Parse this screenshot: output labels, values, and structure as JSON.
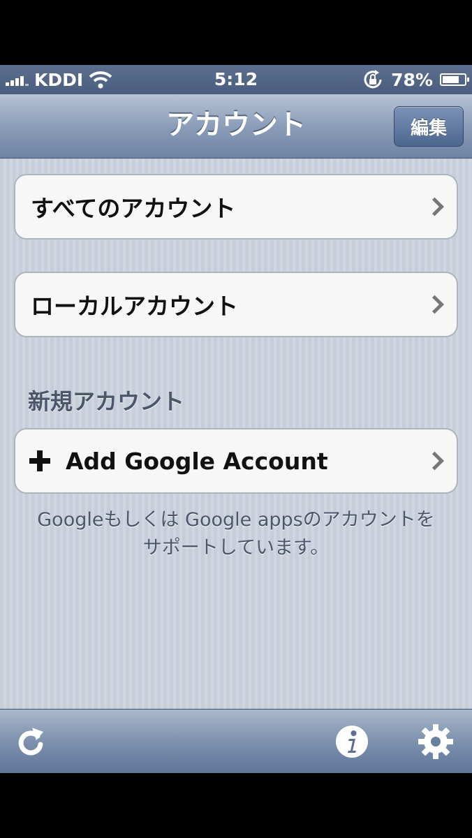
{
  "status_bar": {
    "carrier": "KDDI",
    "time": "5:12",
    "battery_percent": "78%",
    "battery_level": 0.78
  },
  "nav_bar": {
    "title": "アカウント",
    "edit_label": "編集"
  },
  "accounts": {
    "all_accounts_label": "すべてのアカウント",
    "local_accounts_label": "ローカルアカウント"
  },
  "new_account": {
    "section_header": "新規アカウント",
    "add_google_label": "Add Google Account",
    "footer_note": "Googleもしくは Google appsのアカウントをサポートしています。"
  },
  "toolbar": {
    "icons": [
      "refresh-icon",
      "info-icon",
      "settings-gear-icon"
    ]
  }
}
